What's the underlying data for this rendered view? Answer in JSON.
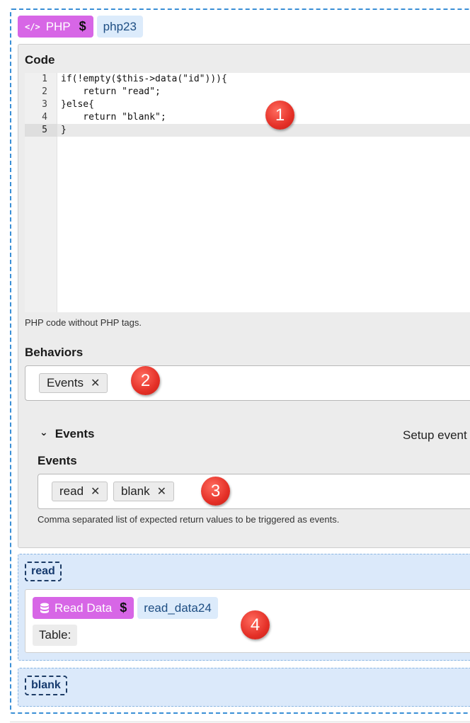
{
  "block": {
    "type_icon": "code-icon",
    "type_label": "PHP",
    "dollar": "$",
    "id": "php23"
  },
  "code_field": {
    "label": "Code",
    "lines": [
      {
        "n": "1",
        "text": "if(!empty($this->data(\"id\"))){"
      },
      {
        "n": "2",
        "text": "    return \"read\";"
      },
      {
        "n": "3",
        "text": "}else{"
      },
      {
        "n": "4",
        "text": "    return \"blank\";"
      },
      {
        "n": "5",
        "text": "}"
      }
    ],
    "help": "PHP code without PHP tags."
  },
  "behaviors": {
    "label": "Behaviors",
    "chips": [
      {
        "label": "Events",
        "remove": "✕"
      }
    ]
  },
  "events_section": {
    "chevron": "⌄",
    "title": "Events",
    "setup_text": "Setup event",
    "field_label": "Events",
    "chips": [
      {
        "label": "read",
        "remove": "✕"
      },
      {
        "label": "blank",
        "remove": "✕"
      }
    ],
    "help": "Comma separated list of expected return values to be triggered as events."
  },
  "read_branch": {
    "label": "read",
    "block": {
      "type_icon": "database-icon",
      "type_label": "Read Data",
      "dollar": "$",
      "id": "read_data24",
      "table_label": "Table:"
    }
  },
  "blank_branch": {
    "label": "blank"
  },
  "callouts": [
    "1",
    "2",
    "3",
    "4"
  ],
  "colors": {
    "php_tag": "#d766e6",
    "id_tag": "#dcebfb",
    "dashed_border": "#3a8fd6",
    "callout": "#e43027",
    "branch_bg": "#dbe9fa"
  }
}
